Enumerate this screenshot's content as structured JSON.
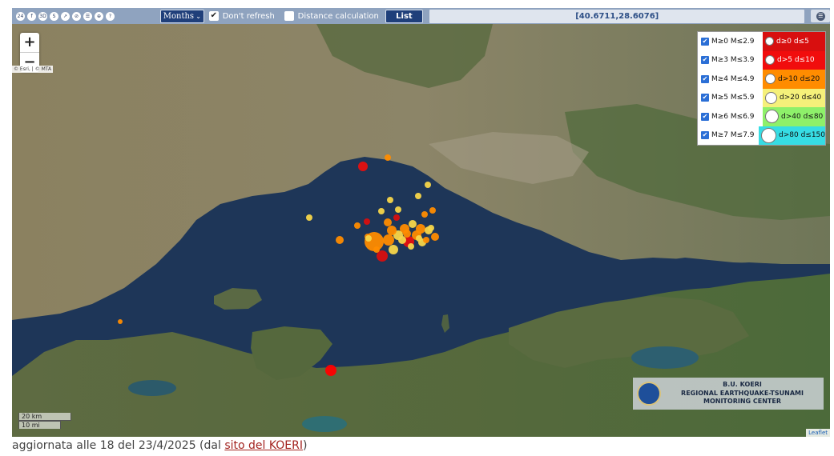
{
  "toolbar": {
    "icons": [
      "24h-icon",
      "info-icon",
      "3d-icon",
      "search-icon",
      "ruler-icon",
      "no-layer-icon",
      "list-icon",
      "locate-icon",
      "help-icon"
    ],
    "icon_glyphs": [
      "24",
      "f",
      "3D",
      "S",
      "↗",
      "⊘",
      "☰",
      "⊕",
      "?"
    ],
    "period_value": "Months",
    "dont_refresh_label": "Don't refresh",
    "dont_refresh_checked": true,
    "distance_label": "Distance calculation",
    "distance_checked": false,
    "list_label": "List",
    "coords": "[40.6711,28.6076]"
  },
  "map": {
    "zoom_in": "+",
    "zoom_out": "−",
    "attribution_top": "© Esri, | © MTA",
    "scale_km": "20 km",
    "scale_mi": "10 mi",
    "leaflet": "Leaflet",
    "logo_lines": [
      "B.U. KOERI",
      "REGIONAL EARTHQUAKE-TSUNAMI",
      "MONITORING CENTER"
    ]
  },
  "legend": {
    "rows": [
      {
        "mag": "M≥0  M≤2.9",
        "depth": "d≥0   d≤5",
        "color": "#d80f0f",
        "text_color": "#ffffff"
      },
      {
        "mag": "M≥3  M≤3.9",
        "depth": "d>5   d≤10",
        "color": "#f10d0d",
        "text_color": "#ffffff"
      },
      {
        "mag": "M≥4  M≤4.9",
        "depth": "d>10  d≤20",
        "color": "#ff8c00",
        "text_color": "#111111"
      },
      {
        "mag": "M≥5  M≤5.9",
        "depth": "d>20  d≤40",
        "color": "#f5f07a",
        "text_color": "#111111"
      },
      {
        "mag": "M≥6  M≤6.9",
        "depth": "d>40  d≤80",
        "color": "#8ef06a",
        "text_color": "#111111"
      },
      {
        "mag": "M≥7  M≤7.9",
        "depth": "d>80 d≤150",
        "color": "#36dde4",
        "text_color": "#111111"
      }
    ]
  },
  "caption": {
    "prefix": "aggiornata alle 18 del 23/4/2025 (dal ",
    "link": "sito del KOERI",
    "suffix": ")"
  },
  "colors": {
    "sea": "#1d3556",
    "land_north": "#8f8565",
    "land_south": "#566a3f",
    "toolbar": "#8fa3bf"
  }
}
